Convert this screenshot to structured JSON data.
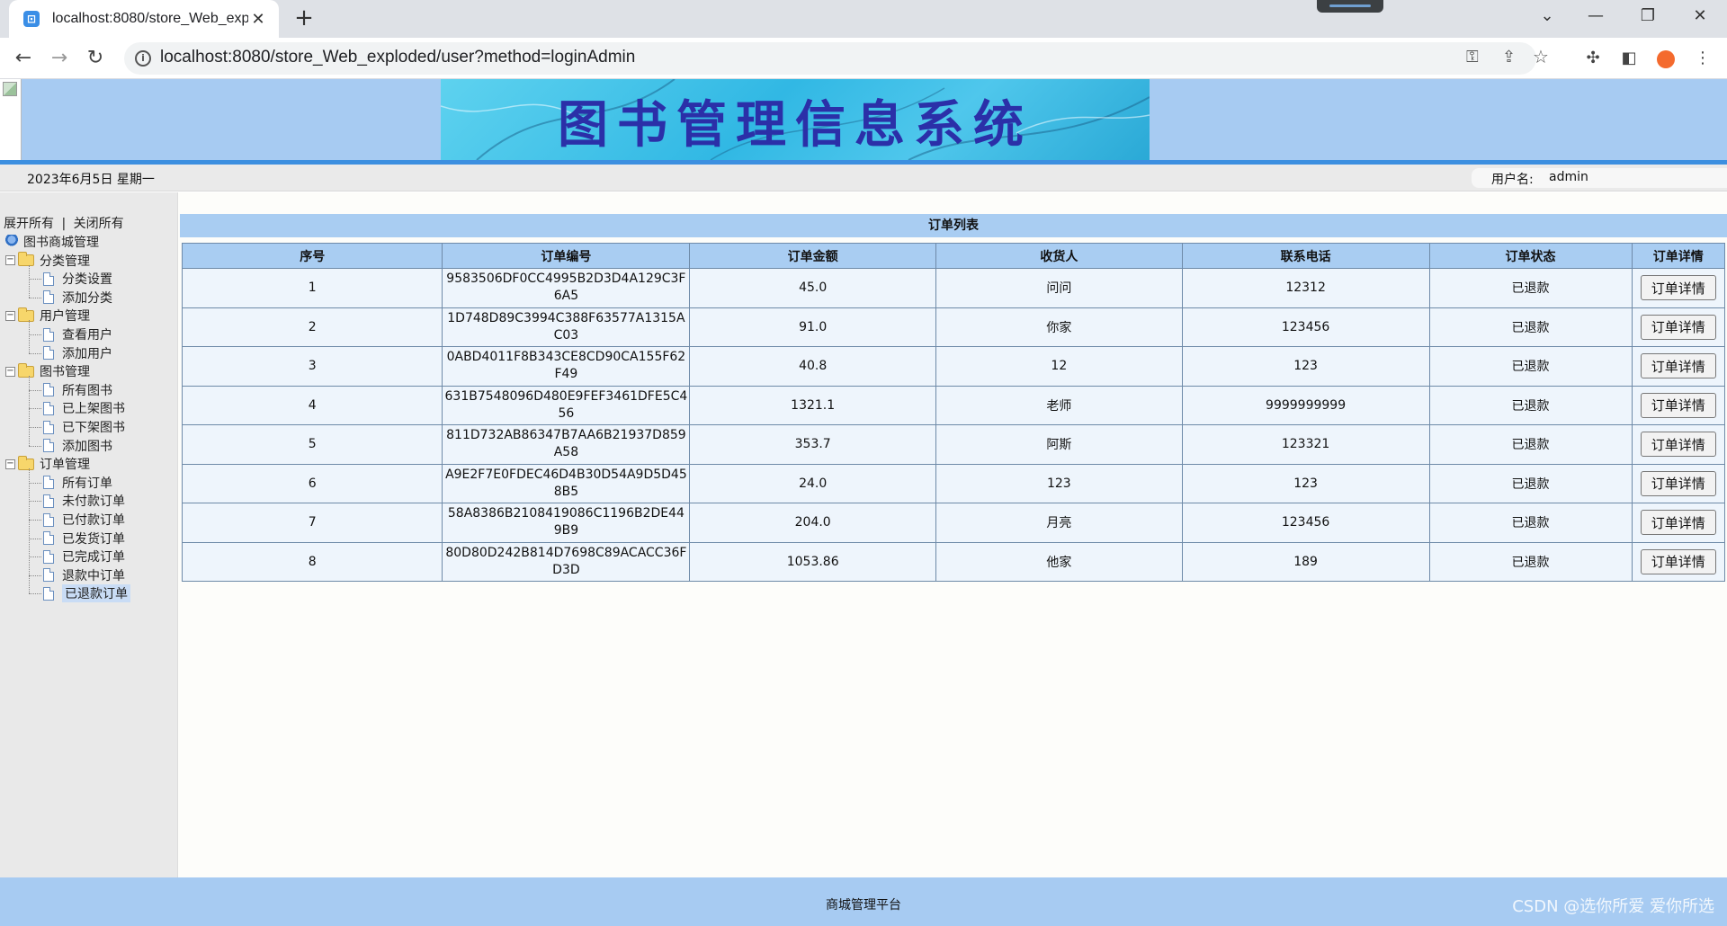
{
  "browser": {
    "tab_title": "localhost:8080/store_Web_exp",
    "url": "localhost:8080/store_Web_exploded/user?method=loginAdmin"
  },
  "header": {
    "banner_text": "图书管理信息系统",
    "date": "2023年6月5日 星期一",
    "user_label": "用户名:",
    "user_name": "admin"
  },
  "sidebar": {
    "expand_all": "展开所有",
    "separator": "|",
    "collapse_all": "关闭所有",
    "root": "图书商城管理",
    "groups": [
      {
        "label": "分类管理",
        "items": [
          "分类设置",
          "添加分类"
        ]
      },
      {
        "label": "用户管理",
        "items": [
          "查看用户",
          "添加用户"
        ]
      },
      {
        "label": "图书管理",
        "items": [
          "所有图书",
          "已上架图书",
          "已下架图书",
          "添加图书"
        ]
      },
      {
        "label": "订单管理",
        "items": [
          "所有订单",
          "未付款订单",
          "已付款订单",
          "已发货订单",
          "已完成订单",
          "退款中订单",
          "已退款订单"
        ]
      }
    ]
  },
  "main": {
    "title": "订单列表",
    "columns": [
      "序号",
      "订单编号",
      "订单金额",
      "收货人",
      "联系电话",
      "订单状态",
      "订单详情"
    ],
    "detail_label": "订单详情",
    "rows": [
      {
        "no": "1",
        "order_id": "9583506DF0CC4995B2D3D4A129C3F6A5",
        "amount": "45.0",
        "receiver": "问问",
        "phone": "12312",
        "status": "已退款"
      },
      {
        "no": "2",
        "order_id": "1D748D89C3994C388F63577A1315AC03",
        "amount": "91.0",
        "receiver": "你家",
        "phone": "123456",
        "status": "已退款"
      },
      {
        "no": "3",
        "order_id": "0ABD4011F8B343CE8CD90CA155F62F49",
        "amount": "40.8",
        "receiver": "12",
        "phone": "123",
        "status": "已退款"
      },
      {
        "no": "4",
        "order_id": "631B7548096D480E9FEF3461DFE5C456",
        "amount": "1321.1",
        "receiver": "老师",
        "phone": "9999999999",
        "status": "已退款"
      },
      {
        "no": "5",
        "order_id": "811D732AB86347B7AA6B21937D859A58",
        "amount": "353.7",
        "receiver": "阿斯",
        "phone": "123321",
        "status": "已退款"
      },
      {
        "no": "6",
        "order_id": "A9E2F7E0FDEC46D4B30D54A9D5D458B5",
        "amount": "24.0",
        "receiver": "123",
        "phone": "123",
        "status": "已退款"
      },
      {
        "no": "7",
        "order_id": "58A8386B2108419086C1196B2DE449B9",
        "amount": "204.0",
        "receiver": "月亮",
        "phone": "123456",
        "status": "已退款"
      },
      {
        "no": "8",
        "order_id": "80D80D242B814D7698C89ACACC36FD3D",
        "amount": "1053.86",
        "receiver": "他家",
        "phone": "189",
        "status": "已退款"
      }
    ]
  },
  "footer": {
    "text": "商城管理平台",
    "watermark": "CSDN @选你所爱 爱你所选"
  }
}
